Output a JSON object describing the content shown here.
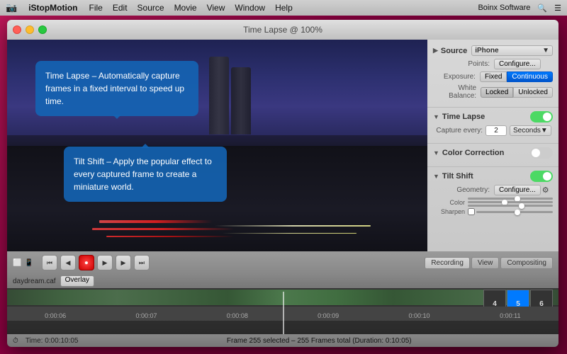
{
  "menubar": {
    "app_name": "iStopMotion",
    "menus": [
      "File",
      "Edit",
      "Source",
      "Movie",
      "View",
      "Window",
      "Help"
    ],
    "right": "Boinx Software",
    "search_icon": "🔍",
    "menu_icon": "☰"
  },
  "window": {
    "title": "Time Lapse @ 100%",
    "traffic_lights": {
      "close": "close",
      "minimize": "minimize",
      "maximize": "maximize"
    }
  },
  "tooltip1": {
    "text": "Time Lapse – Automatically capture frames in a fixed interval to speed up time."
  },
  "tooltip2": {
    "text": "Tilt Shift – Apply the popular effect to every captured frame to create a miniature world."
  },
  "right_panel": {
    "source_label": "Source",
    "source_device": "iPhone",
    "points_label": "Points:",
    "configure_label": "Configure...",
    "exposure_label": "Exposure:",
    "fixed_label": "Fixed",
    "continuous_label": "Continuous",
    "wb_label": "White Balance:",
    "locked_label": "Locked",
    "unlocked_label": "Unlocked",
    "time_lapse_label": "Time Lapse",
    "capture_every_label": "Capture every:",
    "capture_value": "2",
    "seconds_label": "Seconds",
    "color_correction_label": "Color Correction",
    "tilt_shift_label": "Tilt Shift",
    "geometry_label": "Geometry:",
    "configure2_label": "Configure...",
    "color_label": "Color",
    "sharpen_label": "Sharpen"
  },
  "toolbar": {
    "overlay_label": "Overlay",
    "recording_label": "Recording",
    "view_label": "View",
    "compositing_label": "Compositing"
  },
  "timeline": {
    "track_label": "daydream.caf",
    "time_start": "0:00:06",
    "time_2": "0:00:07",
    "time_3": "0:00:08",
    "time_4": "0:00:09",
    "time_5": "0:00:10",
    "time_end": "0:00:11"
  },
  "status": {
    "time": "Time: 0:00:10:05",
    "frame_info": "Frame 255 selected – 255 Frames total (Duration: 0:10:05)"
  },
  "badges": {
    "b4": "4",
    "b5": "5",
    "b6": "6"
  }
}
